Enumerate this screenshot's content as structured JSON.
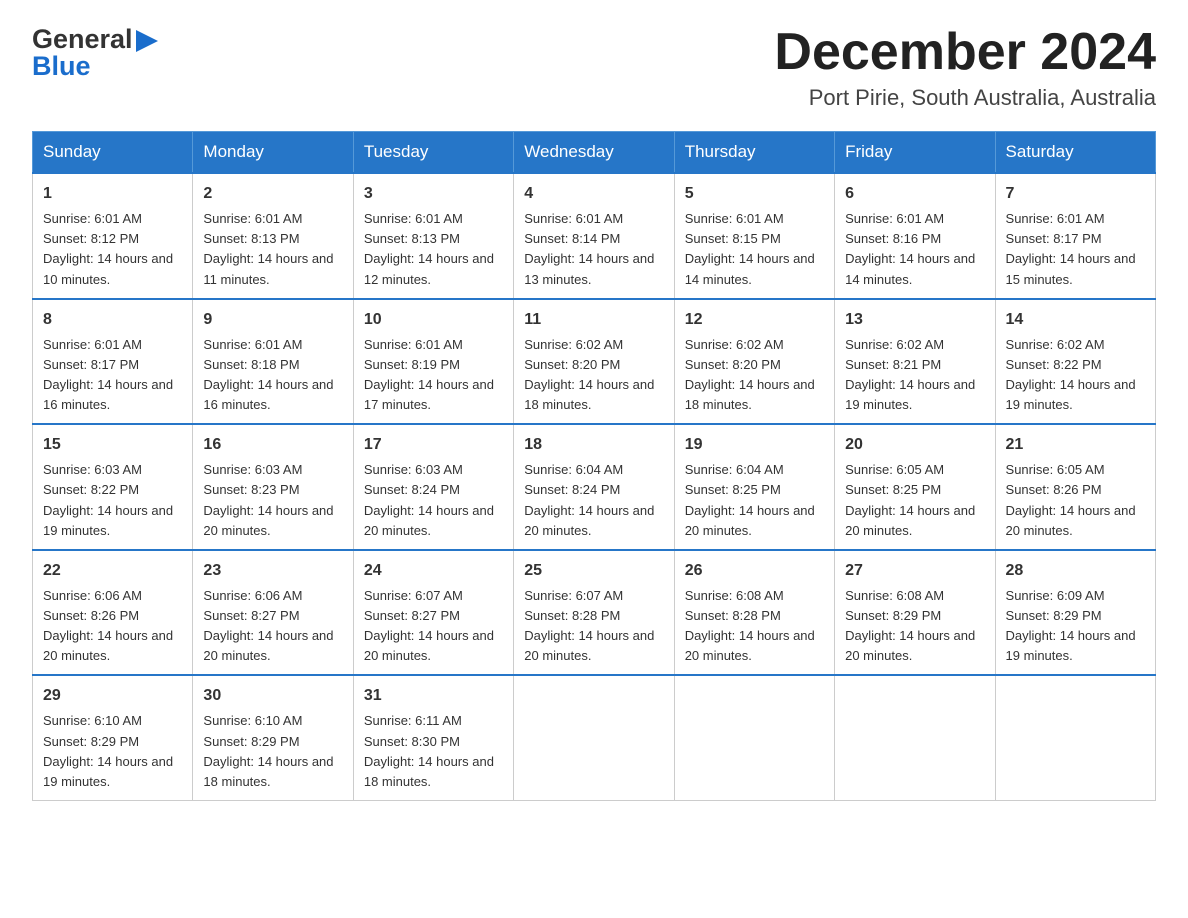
{
  "header": {
    "logo_general": "General",
    "logo_blue": "Blue",
    "month_title": "December 2024",
    "subtitle": "Port Pirie, South Australia, Australia"
  },
  "days_of_week": [
    "Sunday",
    "Monday",
    "Tuesday",
    "Wednesday",
    "Thursday",
    "Friday",
    "Saturday"
  ],
  "weeks": [
    [
      {
        "day": "1",
        "sunrise": "Sunrise: 6:01 AM",
        "sunset": "Sunset: 8:12 PM",
        "daylight": "Daylight: 14 hours and 10 minutes."
      },
      {
        "day": "2",
        "sunrise": "Sunrise: 6:01 AM",
        "sunset": "Sunset: 8:13 PM",
        "daylight": "Daylight: 14 hours and 11 minutes."
      },
      {
        "day": "3",
        "sunrise": "Sunrise: 6:01 AM",
        "sunset": "Sunset: 8:13 PM",
        "daylight": "Daylight: 14 hours and 12 minutes."
      },
      {
        "day": "4",
        "sunrise": "Sunrise: 6:01 AM",
        "sunset": "Sunset: 8:14 PM",
        "daylight": "Daylight: 14 hours and 13 minutes."
      },
      {
        "day": "5",
        "sunrise": "Sunrise: 6:01 AM",
        "sunset": "Sunset: 8:15 PM",
        "daylight": "Daylight: 14 hours and 14 minutes."
      },
      {
        "day": "6",
        "sunrise": "Sunrise: 6:01 AM",
        "sunset": "Sunset: 8:16 PM",
        "daylight": "Daylight: 14 hours and 14 minutes."
      },
      {
        "day": "7",
        "sunrise": "Sunrise: 6:01 AM",
        "sunset": "Sunset: 8:17 PM",
        "daylight": "Daylight: 14 hours and 15 minutes."
      }
    ],
    [
      {
        "day": "8",
        "sunrise": "Sunrise: 6:01 AM",
        "sunset": "Sunset: 8:17 PM",
        "daylight": "Daylight: 14 hours and 16 minutes."
      },
      {
        "day": "9",
        "sunrise": "Sunrise: 6:01 AM",
        "sunset": "Sunset: 8:18 PM",
        "daylight": "Daylight: 14 hours and 16 minutes."
      },
      {
        "day": "10",
        "sunrise": "Sunrise: 6:01 AM",
        "sunset": "Sunset: 8:19 PM",
        "daylight": "Daylight: 14 hours and 17 minutes."
      },
      {
        "day": "11",
        "sunrise": "Sunrise: 6:02 AM",
        "sunset": "Sunset: 8:20 PM",
        "daylight": "Daylight: 14 hours and 18 minutes."
      },
      {
        "day": "12",
        "sunrise": "Sunrise: 6:02 AM",
        "sunset": "Sunset: 8:20 PM",
        "daylight": "Daylight: 14 hours and 18 minutes."
      },
      {
        "day": "13",
        "sunrise": "Sunrise: 6:02 AM",
        "sunset": "Sunset: 8:21 PM",
        "daylight": "Daylight: 14 hours and 19 minutes."
      },
      {
        "day": "14",
        "sunrise": "Sunrise: 6:02 AM",
        "sunset": "Sunset: 8:22 PM",
        "daylight": "Daylight: 14 hours and 19 minutes."
      }
    ],
    [
      {
        "day": "15",
        "sunrise": "Sunrise: 6:03 AM",
        "sunset": "Sunset: 8:22 PM",
        "daylight": "Daylight: 14 hours and 19 minutes."
      },
      {
        "day": "16",
        "sunrise": "Sunrise: 6:03 AM",
        "sunset": "Sunset: 8:23 PM",
        "daylight": "Daylight: 14 hours and 20 minutes."
      },
      {
        "day": "17",
        "sunrise": "Sunrise: 6:03 AM",
        "sunset": "Sunset: 8:24 PM",
        "daylight": "Daylight: 14 hours and 20 minutes."
      },
      {
        "day": "18",
        "sunrise": "Sunrise: 6:04 AM",
        "sunset": "Sunset: 8:24 PM",
        "daylight": "Daylight: 14 hours and 20 minutes."
      },
      {
        "day": "19",
        "sunrise": "Sunrise: 6:04 AM",
        "sunset": "Sunset: 8:25 PM",
        "daylight": "Daylight: 14 hours and 20 minutes."
      },
      {
        "day": "20",
        "sunrise": "Sunrise: 6:05 AM",
        "sunset": "Sunset: 8:25 PM",
        "daylight": "Daylight: 14 hours and 20 minutes."
      },
      {
        "day": "21",
        "sunrise": "Sunrise: 6:05 AM",
        "sunset": "Sunset: 8:26 PM",
        "daylight": "Daylight: 14 hours and 20 minutes."
      }
    ],
    [
      {
        "day": "22",
        "sunrise": "Sunrise: 6:06 AM",
        "sunset": "Sunset: 8:26 PM",
        "daylight": "Daylight: 14 hours and 20 minutes."
      },
      {
        "day": "23",
        "sunrise": "Sunrise: 6:06 AM",
        "sunset": "Sunset: 8:27 PM",
        "daylight": "Daylight: 14 hours and 20 minutes."
      },
      {
        "day": "24",
        "sunrise": "Sunrise: 6:07 AM",
        "sunset": "Sunset: 8:27 PM",
        "daylight": "Daylight: 14 hours and 20 minutes."
      },
      {
        "day": "25",
        "sunrise": "Sunrise: 6:07 AM",
        "sunset": "Sunset: 8:28 PM",
        "daylight": "Daylight: 14 hours and 20 minutes."
      },
      {
        "day": "26",
        "sunrise": "Sunrise: 6:08 AM",
        "sunset": "Sunset: 8:28 PM",
        "daylight": "Daylight: 14 hours and 20 minutes."
      },
      {
        "day": "27",
        "sunrise": "Sunrise: 6:08 AM",
        "sunset": "Sunset: 8:29 PM",
        "daylight": "Daylight: 14 hours and 20 minutes."
      },
      {
        "day": "28",
        "sunrise": "Sunrise: 6:09 AM",
        "sunset": "Sunset: 8:29 PM",
        "daylight": "Daylight: 14 hours and 19 minutes."
      }
    ],
    [
      {
        "day": "29",
        "sunrise": "Sunrise: 6:10 AM",
        "sunset": "Sunset: 8:29 PM",
        "daylight": "Daylight: 14 hours and 19 minutes."
      },
      {
        "day": "30",
        "sunrise": "Sunrise: 6:10 AM",
        "sunset": "Sunset: 8:29 PM",
        "daylight": "Daylight: 14 hours and 18 minutes."
      },
      {
        "day": "31",
        "sunrise": "Sunrise: 6:11 AM",
        "sunset": "Sunset: 8:30 PM",
        "daylight": "Daylight: 14 hours and 18 minutes."
      },
      null,
      null,
      null,
      null
    ]
  ]
}
